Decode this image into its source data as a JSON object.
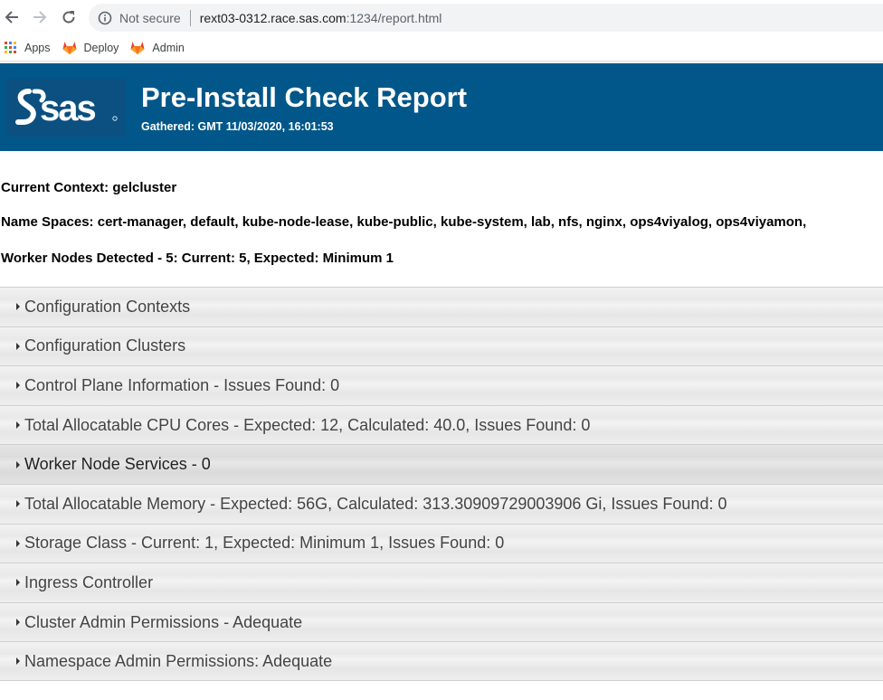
{
  "browser": {
    "security_label": "Not secure",
    "url_host": "rext03-0312.race.sas.com",
    "url_path": ":1234/report.html",
    "bookmarks": [
      {
        "label": "Apps",
        "icon": "apps-grid-icon"
      },
      {
        "label": "Deploy",
        "icon": "gitlab-icon"
      },
      {
        "label": "Admin",
        "icon": "gitlab-icon"
      }
    ]
  },
  "banner": {
    "logo_text": "Ssas",
    "title": "Pre-Install Check Report",
    "gathered": "Gathered: GMT 11/03/2020, 16:01:53",
    "background": "#01578a"
  },
  "summary": {
    "context": "Current Context: gelcluster",
    "namespaces": "Name Spaces: cert-manager, default, kube-node-lease, kube-public, kube-system, lab, nfs, nginx, ops4viyalog, ops4viyamon,",
    "workers": "Worker Nodes Detected - 5: Current: 5, Expected: Minimum 1"
  },
  "sections": [
    {
      "label": "Configuration Contexts"
    },
    {
      "label": "Configuration Clusters"
    },
    {
      "label": "Control Plane Information - Issues Found: 0"
    },
    {
      "label": "Total Allocatable CPU Cores - Expected: 12, Calculated: 40.0, Issues Found: 0"
    },
    {
      "label": "Worker Node Services - 0"
    },
    {
      "label": "Total Allocatable Memory - Expected: 56G, Calculated: 313.30909729003906 Gi, Issues Found: 0"
    },
    {
      "label": "Storage Class - Current: 1, Expected: Minimum 1, Issues Found: 0"
    },
    {
      "label": "Ingress Controller"
    },
    {
      "label": "Cluster Admin Permissions - Adequate"
    },
    {
      "label": "Namespace Admin Permissions: Adequate"
    }
  ]
}
